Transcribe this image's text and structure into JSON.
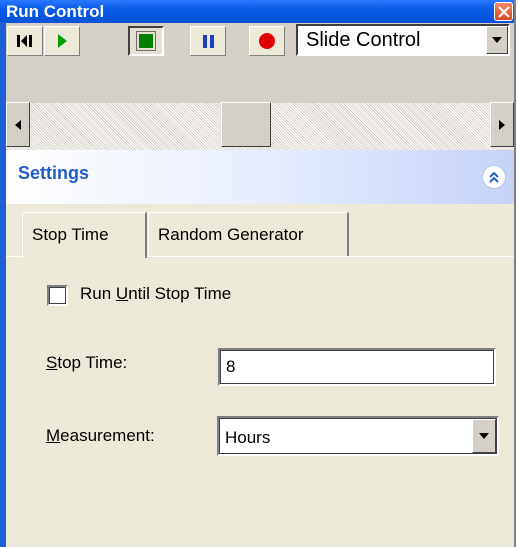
{
  "window": {
    "title": "Run Control"
  },
  "toolbar": {
    "buttons": [
      {
        "name": "step-to-start",
        "icon": "skip-back-icon"
      },
      {
        "name": "play",
        "icon": "play-icon",
        "color": "#00a000"
      },
      {
        "name": "stop",
        "icon": "stop-icon",
        "color": "#008000",
        "pressed": true
      },
      {
        "name": "pause",
        "icon": "pause-icon",
        "color": "#1e3fbf"
      },
      {
        "name": "record",
        "icon": "record-icon",
        "color": "#e00000"
      }
    ],
    "mode_select": {
      "value": "Slide Control"
    }
  },
  "settings": {
    "title": "Settings",
    "tabs": [
      {
        "label": "Stop Time",
        "active": true
      },
      {
        "label": "Random Generator",
        "active": false
      }
    ],
    "run_until_stop_time": {
      "label_pre": "Run ",
      "label_accel": "U",
      "label_post": "ntil Stop Time",
      "checked": false
    },
    "stop_time": {
      "label_accel": "S",
      "label_post": "top Time:",
      "value": "8"
    },
    "measurement": {
      "label_accel": "M",
      "label_post": "easurement:",
      "value": "Hours"
    }
  },
  "colors": {
    "titlebar": "#0a5ae6",
    "settings_title": "#215dc6",
    "panel_bg": "#ece9d8"
  }
}
